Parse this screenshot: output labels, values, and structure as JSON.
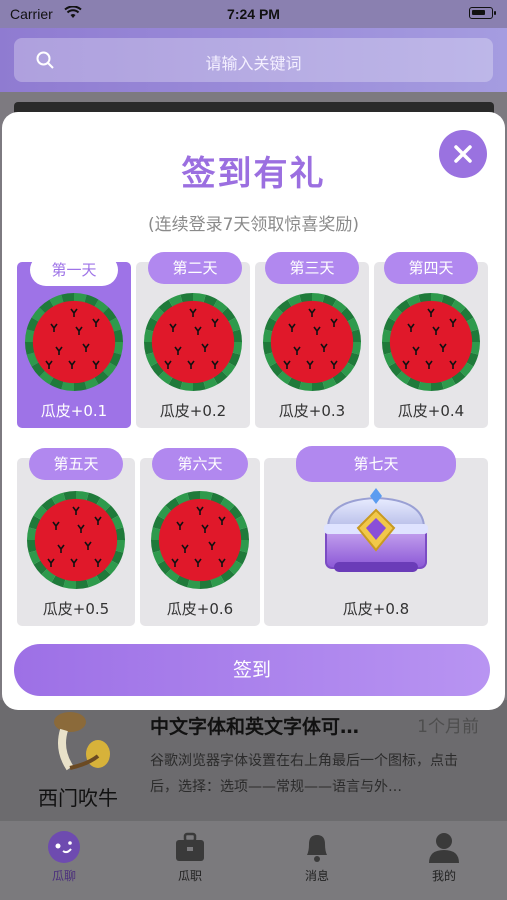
{
  "status_bar": {
    "carrier": "Carrier",
    "time": "7:24 PM"
  },
  "search": {
    "placeholder": "请输入关键词"
  },
  "feed_item": {
    "author": "西门吹牛",
    "title": "中文字体和英文字体可…",
    "time": "1个月前",
    "summary": "谷歌浏览器字体设置在右上角最后一个图标，点击后，选择：选项——常规——语言与外…"
  },
  "modal": {
    "title": "签到有礼",
    "subtitle": "(连续登录7天领取惊喜奖励)",
    "days": [
      {
        "label": "第一天",
        "reward": "瓜皮+0.1",
        "active": true,
        "icon": "watermelon-icon"
      },
      {
        "label": "第二天",
        "reward": "瓜皮+0.2",
        "active": false,
        "icon": "watermelon-icon"
      },
      {
        "label": "第三天",
        "reward": "瓜皮+0.3",
        "active": false,
        "icon": "watermelon-icon"
      },
      {
        "label": "第四天",
        "reward": "瓜皮+0.4",
        "active": false,
        "icon": "watermelon-icon"
      },
      {
        "label": "第五天",
        "reward": "瓜皮+0.5",
        "active": false,
        "icon": "watermelon-icon"
      },
      {
        "label": "第六天",
        "reward": "瓜皮+0.6",
        "active": false,
        "icon": "watermelon-icon"
      },
      {
        "label": "第七天",
        "reward": "瓜皮+0.8",
        "active": false,
        "icon": "treasure-chest-icon"
      }
    ],
    "checkin_label": "签到"
  },
  "tabs": [
    {
      "label": "瓜聊",
      "icon": "chat-bubble-icon",
      "active": true
    },
    {
      "label": "瓜职",
      "icon": "briefcase-icon",
      "active": false
    },
    {
      "label": "消息",
      "icon": "bell-icon",
      "active": false
    },
    {
      "label": "我的",
      "icon": "person-icon",
      "active": false
    }
  ],
  "colors": {
    "accent": "#9e73e7",
    "watermelon_red": "#e0182a",
    "watermelon_rind": "#1f7a3a"
  }
}
